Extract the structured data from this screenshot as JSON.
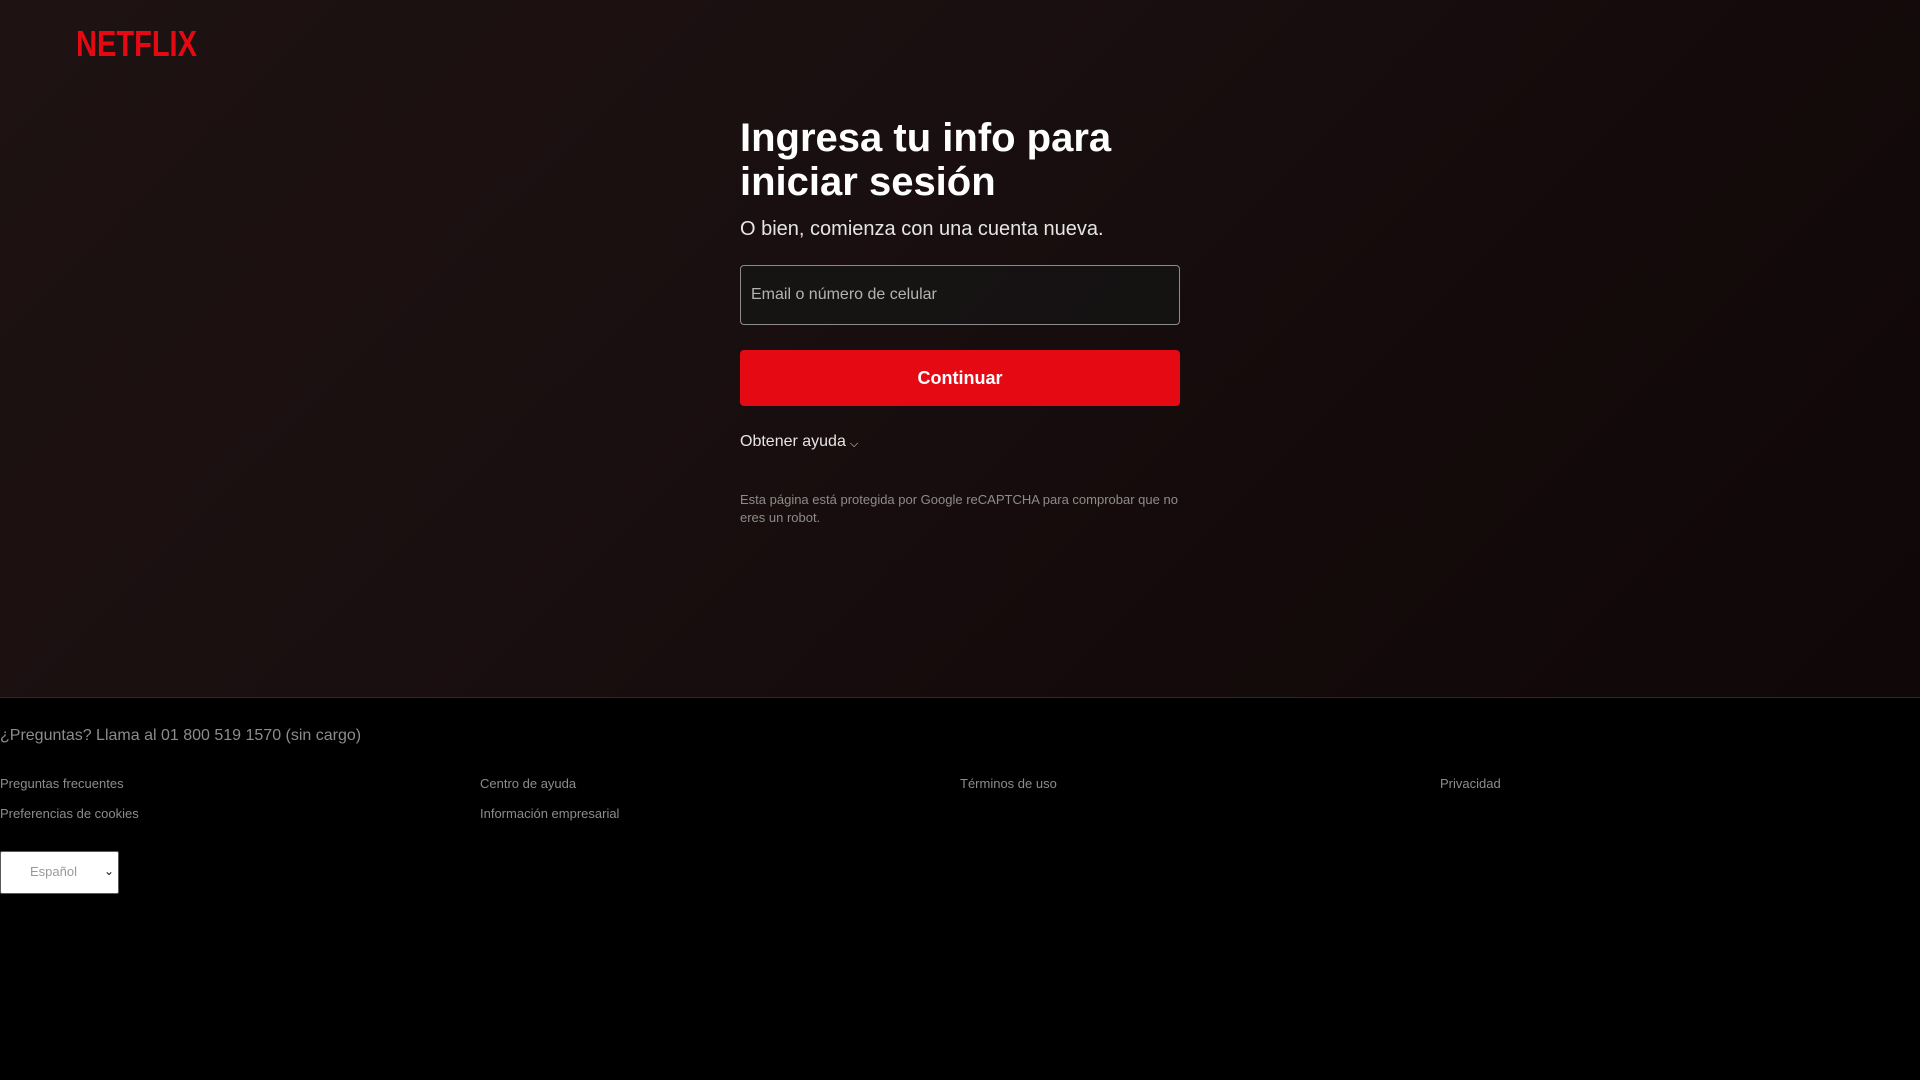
{
  "brand": {
    "logo_text": "NETFLIX",
    "color": "#e50914"
  },
  "login": {
    "title_line1": "Ingresa tu info para",
    "title_line2": "iniciar sesión",
    "subtitle": "O bien, comienza con una cuenta nueva.",
    "email_placeholder": "Email o número de celular",
    "email_value": "",
    "continue_label": "Continuar",
    "help_label": "Obtener ayuda",
    "help_icon": "chevron-down-icon",
    "recaptcha_text": "Esta página está protegida por Google reCAPTCHA para comprobar que no eres un robot."
  },
  "footer": {
    "phone_text": "¿Preguntas? Llama al 01 800 519 1570 (sin cargo)",
    "links": [
      "Preguntas frecuentes",
      "Centro de ayuda",
      "Términos de uso",
      "Privacidad",
      "Preferencias de cookies",
      "Información empresarial"
    ],
    "language": {
      "selected": "Español"
    }
  }
}
